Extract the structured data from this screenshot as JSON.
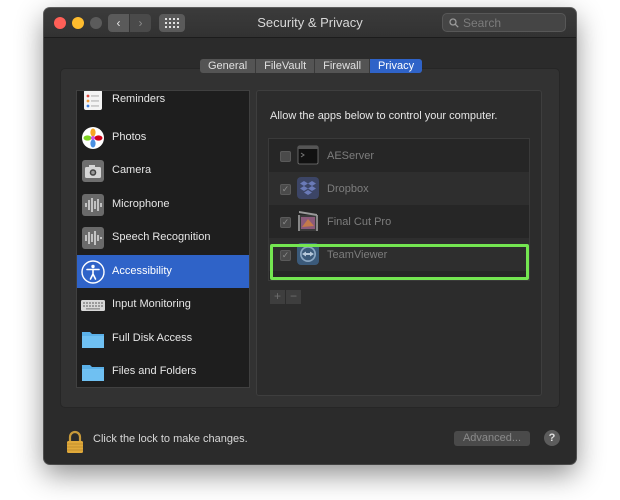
{
  "window": {
    "title": "Security & Privacy",
    "search_placeholder": "Search"
  },
  "tabs": [
    "General",
    "FileVault",
    "Firewall",
    "Privacy"
  ],
  "active_tab": "Privacy",
  "sidebar": {
    "items": [
      {
        "label": "Reminders",
        "icon": "reminders-icon"
      },
      {
        "label": "Photos",
        "icon": "photos-icon"
      },
      {
        "label": "Camera",
        "icon": "camera-icon"
      },
      {
        "label": "Microphone",
        "icon": "microphone-icon"
      },
      {
        "label": "Speech Recognition",
        "icon": "speech-recognition-icon"
      },
      {
        "label": "Accessibility",
        "icon": "accessibility-icon",
        "selected": true
      },
      {
        "label": "Input Monitoring",
        "icon": "keyboard-icon"
      },
      {
        "label": "Full Disk Access",
        "icon": "folder-icon"
      },
      {
        "label": "Files and Folders",
        "icon": "folder-icon"
      }
    ]
  },
  "main": {
    "description": "Allow the apps below to control your computer.",
    "apps": [
      {
        "name": "AEServer",
        "checked": false
      },
      {
        "name": "Dropbox",
        "checked": true
      },
      {
        "name": "Final Cut Pro",
        "checked": true
      },
      {
        "name": "TeamViewer",
        "checked": true,
        "highlighted": true
      }
    ],
    "add_label": "+",
    "remove_label": "−"
  },
  "footer": {
    "lock_text": "Click the lock to make changes.",
    "advanced_label": "Advanced...",
    "help_label": "?"
  },
  "colors": {
    "accent": "#2f63c8",
    "highlight": "#74e651"
  }
}
